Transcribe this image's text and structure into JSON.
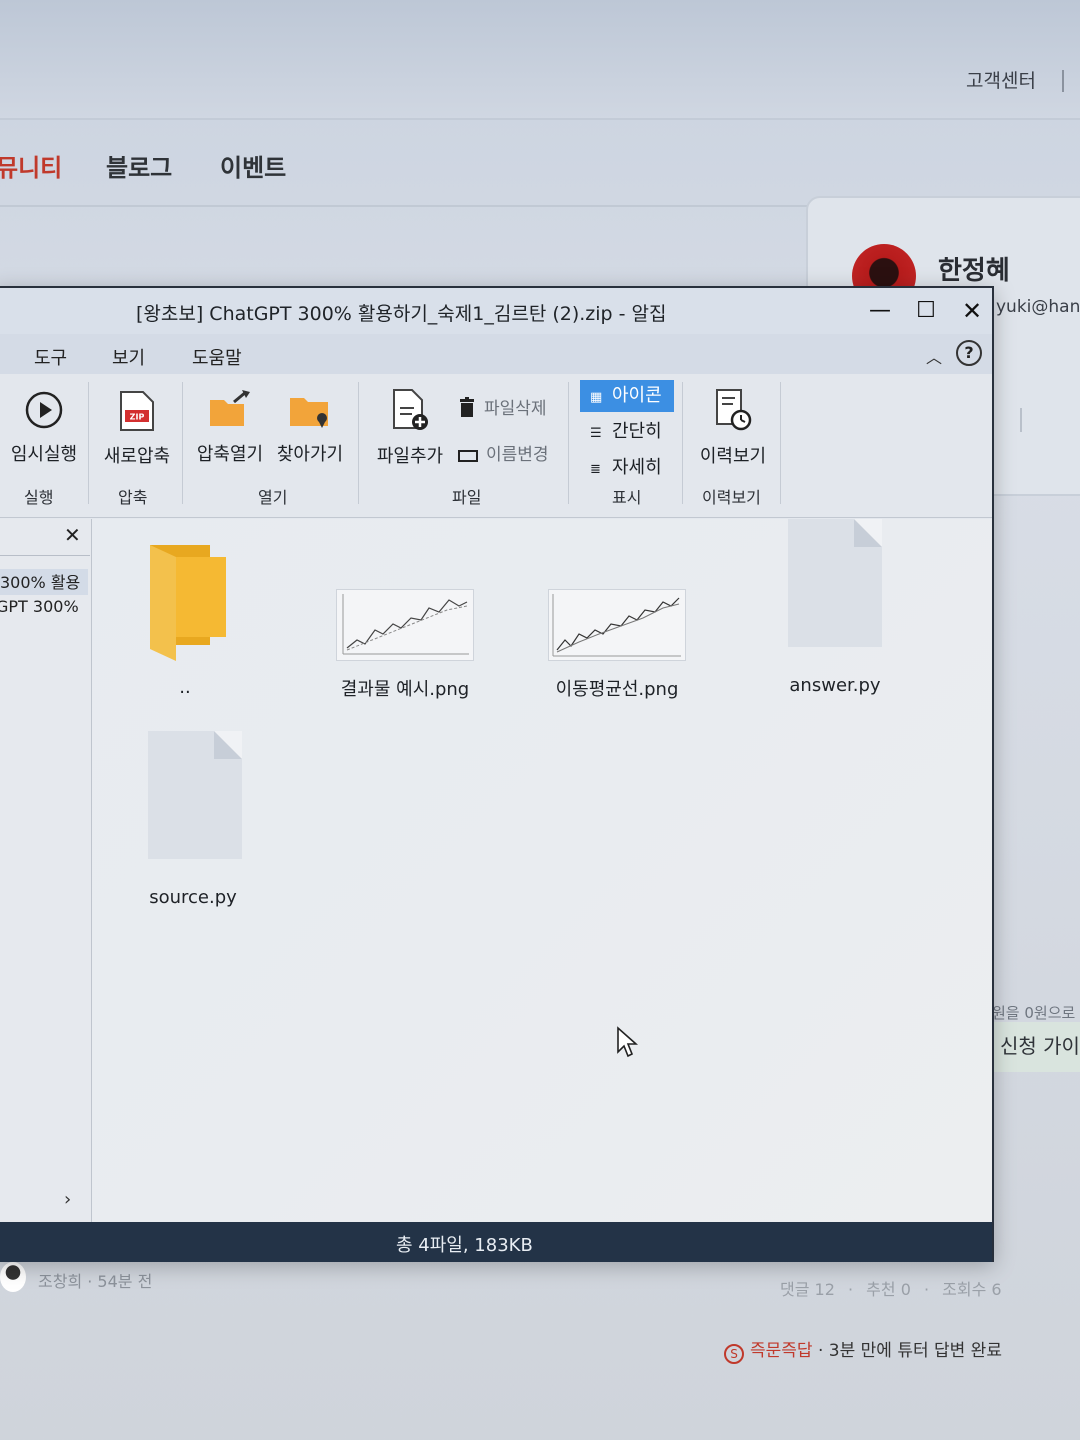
{
  "background_page": {
    "support_link": "고객센터",
    "nav": [
      "커뮤니티",
      "블로그",
      "이벤트"
    ],
    "nav_visible": [
      "뮤니티",
      "블로그",
      "이벤트"
    ],
    "profile": {
      "name": "한정혜",
      "email": "yuki@hani"
    },
    "side_text1": "원을 0원으로",
    "side_text2": "신청 가이",
    "post_author": "조창희 · 54분 전",
    "post_stats": {
      "comments": "댓글 12",
      "likes": "추천 0",
      "views": "조회수 6",
      "separator": "·"
    },
    "answer_badge": {
      "prefix": "즉문즉답",
      "text": "· 3분 만에 튜터 답변 완료"
    }
  },
  "window": {
    "title": "[왕초보] ChatGPT 300% 활용하기_숙제1_김르탄 (2).zip - 알집",
    "controls": {
      "minimize": "—",
      "maximize": "☐",
      "close": "✕"
    },
    "menu": [
      "도구",
      "보기",
      "도움말"
    ],
    "ribbon": {
      "run": {
        "label": "임시실행",
        "group": "실행"
      },
      "compress": {
        "label": "새로압축",
        "group": "압축",
        "zip_badge": "ZIP"
      },
      "open": {
        "buttons": [
          "압축열기",
          "찾아가기"
        ],
        "group": "열기"
      },
      "file": {
        "add": "파일추가",
        "delete": "파일삭제",
        "rename": "이름변경",
        "group": "파일"
      },
      "view": {
        "options": [
          "아이콘",
          "간단히",
          "자세히"
        ],
        "selected": "아이콘",
        "group": "표시"
      },
      "history": {
        "label": "이력보기",
        "group": "이력보기"
      }
    },
    "left_pane": {
      "close": "✕",
      "items": [
        "300% 활용",
        "GPT 300% "
      ],
      "expand": "›"
    },
    "files": [
      {
        "name": "..",
        "type": "folder"
      },
      {
        "name": "결과물 예시.png",
        "type": "image"
      },
      {
        "name": "이동평균선.png",
        "type": "image"
      },
      {
        "name": "answer.py",
        "type": "file"
      },
      {
        "name": "source.py",
        "type": "file"
      }
    ],
    "status": "총 4파일,  183KB"
  }
}
